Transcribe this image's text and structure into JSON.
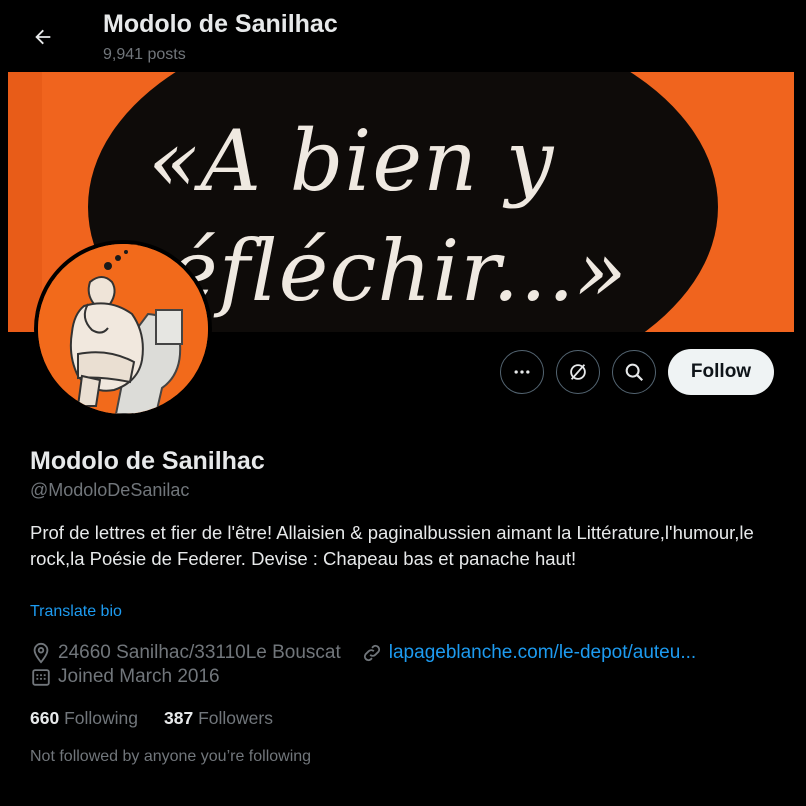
{
  "header": {
    "name": "Modolo de Sanilhac",
    "posts_count": "9,941 posts"
  },
  "banner": {
    "line1": "«A bien y",
    "line2": "éfléchir...»"
  },
  "actions": {
    "follow_label": "Follow"
  },
  "profile": {
    "name": "Modolo de Sanilhac",
    "handle": "@ModoloDeSanilac",
    "bio": "Prof de lettres et fier de l'être! Allaisien & paginalbussien aimant la Littérature,l'humour,le rock,la Poésie de Federer. Devise : Chapeau bas et panache haut!",
    "translate_label": "Translate bio",
    "location": "24660 Sanilhac/33110Le Bouscat",
    "website": "lapageblanche.com/le-depot/auteu...",
    "joined": "Joined March 2016"
  },
  "stats": {
    "following_count": "660",
    "following_label": "Following",
    "followers_count": "387",
    "followers_label": "Followers"
  },
  "not_followed_text": "Not followed by anyone you’re following",
  "colors": {
    "background": "#000000",
    "accent_link": "#1d9bf0",
    "secondary_text": "#71767b",
    "banner_orange": "#f0641e"
  }
}
